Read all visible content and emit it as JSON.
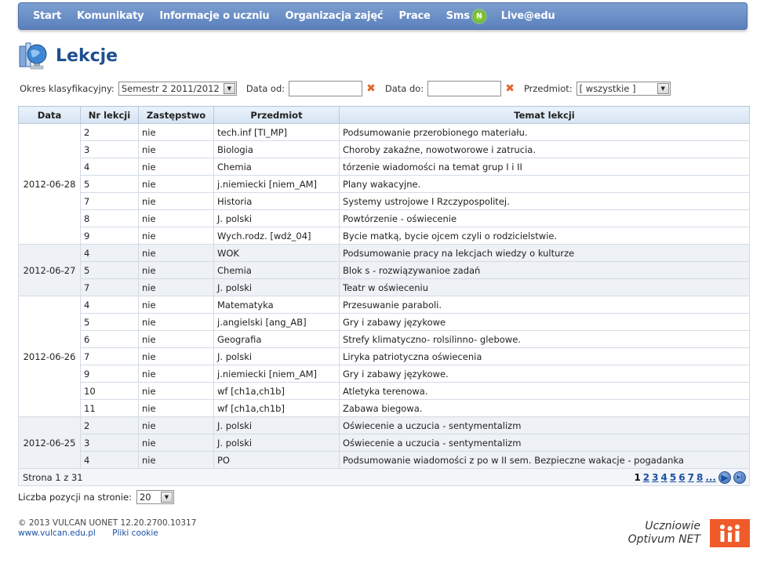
{
  "nav": {
    "items": [
      "Start",
      "Komunikaty",
      "Informacje o uczniu",
      "Organizacja zajęć",
      "Prace",
      "Sms",
      "Live@edu"
    ],
    "sms_badge": "N"
  },
  "page_title": "Lekcje",
  "filters": {
    "period_label": "Okres klasyfikacyjny:",
    "period_value": "Semestr 2 2011/2012",
    "date_from_label": "Data od:",
    "date_from_value": "",
    "date_to_label": "Data do:",
    "date_to_value": "",
    "subject_label": "Przedmiot:",
    "subject_value": "[ wszystkie ]"
  },
  "table": {
    "columns": [
      "Data",
      "Nr lekcji",
      "Zastępstwo",
      "Przedmiot",
      "Temat lekcji"
    ],
    "groups": [
      {
        "date": "2012-06-28",
        "rows": [
          [
            "2",
            "nie",
            "tech.inf [TI_MP]",
            "Podsumowanie przerobionego materiału."
          ],
          [
            "3",
            "nie",
            "Biologia",
            "Choroby zakaźne, nowotworowe i zatrucia."
          ],
          [
            "4",
            "nie",
            "Chemia",
            "tórzenie wiadomości na temat grup I i II"
          ],
          [
            "5",
            "nie",
            "j.niemiecki [niem_AM]",
            "Plany wakacyjne."
          ],
          [
            "7",
            "nie",
            "Historia",
            "Systemy ustrojowe I Rzczypospolitej."
          ],
          [
            "8",
            "nie",
            "J. polski",
            "Powtórzenie - oświecenie"
          ],
          [
            "9",
            "nie",
            "Wych.rodz. [wdż_04]",
            "Bycie matką, bycie ojcem czyli o rodzicielstwie."
          ]
        ]
      },
      {
        "date": "2012-06-27",
        "rows": [
          [
            "4",
            "nie",
            "WOK",
            "Podsumowanie pracy na lekcjach wiedzy o kulturze"
          ],
          [
            "5",
            "nie",
            "Chemia",
            "Blok s - rozwiązywanioe zadań"
          ],
          [
            "7",
            "nie",
            "J. polski",
            "Teatr w oświeceniu"
          ]
        ]
      },
      {
        "date": "2012-06-26",
        "rows": [
          [
            "4",
            "nie",
            "Matematyka",
            "Przesuwanie paraboli."
          ],
          [
            "5",
            "nie",
            "j.angielski [ang_AB]",
            "Gry i zabawy językowe"
          ],
          [
            "6",
            "nie",
            "Geografia",
            "Strefy klimatyczno- rolsilinno- glebowe."
          ],
          [
            "7",
            "nie",
            "J. polski",
            "Liryka patriotyczna oświecenia"
          ],
          [
            "9",
            "nie",
            "j.niemiecki [niem_AM]",
            "Gry i zabawy językowe."
          ],
          [
            "10",
            "nie",
            "wf [ch1a,ch1b]",
            "Atletyka terenowa."
          ],
          [
            "11",
            "nie",
            "wf [ch1a,ch1b]",
            "Zabawa biegowa."
          ]
        ]
      },
      {
        "date": "2012-06-25",
        "rows": [
          [
            "2",
            "nie",
            "J. polski",
            "Oświecenie a uczucia - sentymentalizm"
          ],
          [
            "3",
            "nie",
            "J. polski",
            "Oświecenie a uczucia - sentymentalizm"
          ],
          [
            "4",
            "nie",
            "PO",
            "Podsumowanie wiadomości z po w II sem. Bezpieczne wakacje - pogadanka"
          ]
        ]
      }
    ]
  },
  "pager": {
    "status": "Strona 1 z 31",
    "pages": [
      "1",
      "2",
      "3",
      "4",
      "5",
      "6",
      "7",
      "8",
      "..."
    ],
    "current": "1"
  },
  "per_page": {
    "label": "Liczba pozycji na stronie:",
    "value": "20"
  },
  "footer": {
    "copyright": "© 2013 VULCAN UONET 12.20.2700.10317",
    "link_site": "www.vulcan.edu.pl",
    "link_cookies": "Pliki cookie"
  },
  "brand": {
    "line1": "Uczniowie",
    "line2": "Optivum NET"
  },
  "colors": {
    "nav_bg": "#6a8fc8",
    "title": "#1f4f8f",
    "clear_icon": "#e2662c",
    "brand_logo": "#ef5b2b",
    "link": "#1b4fa3"
  }
}
